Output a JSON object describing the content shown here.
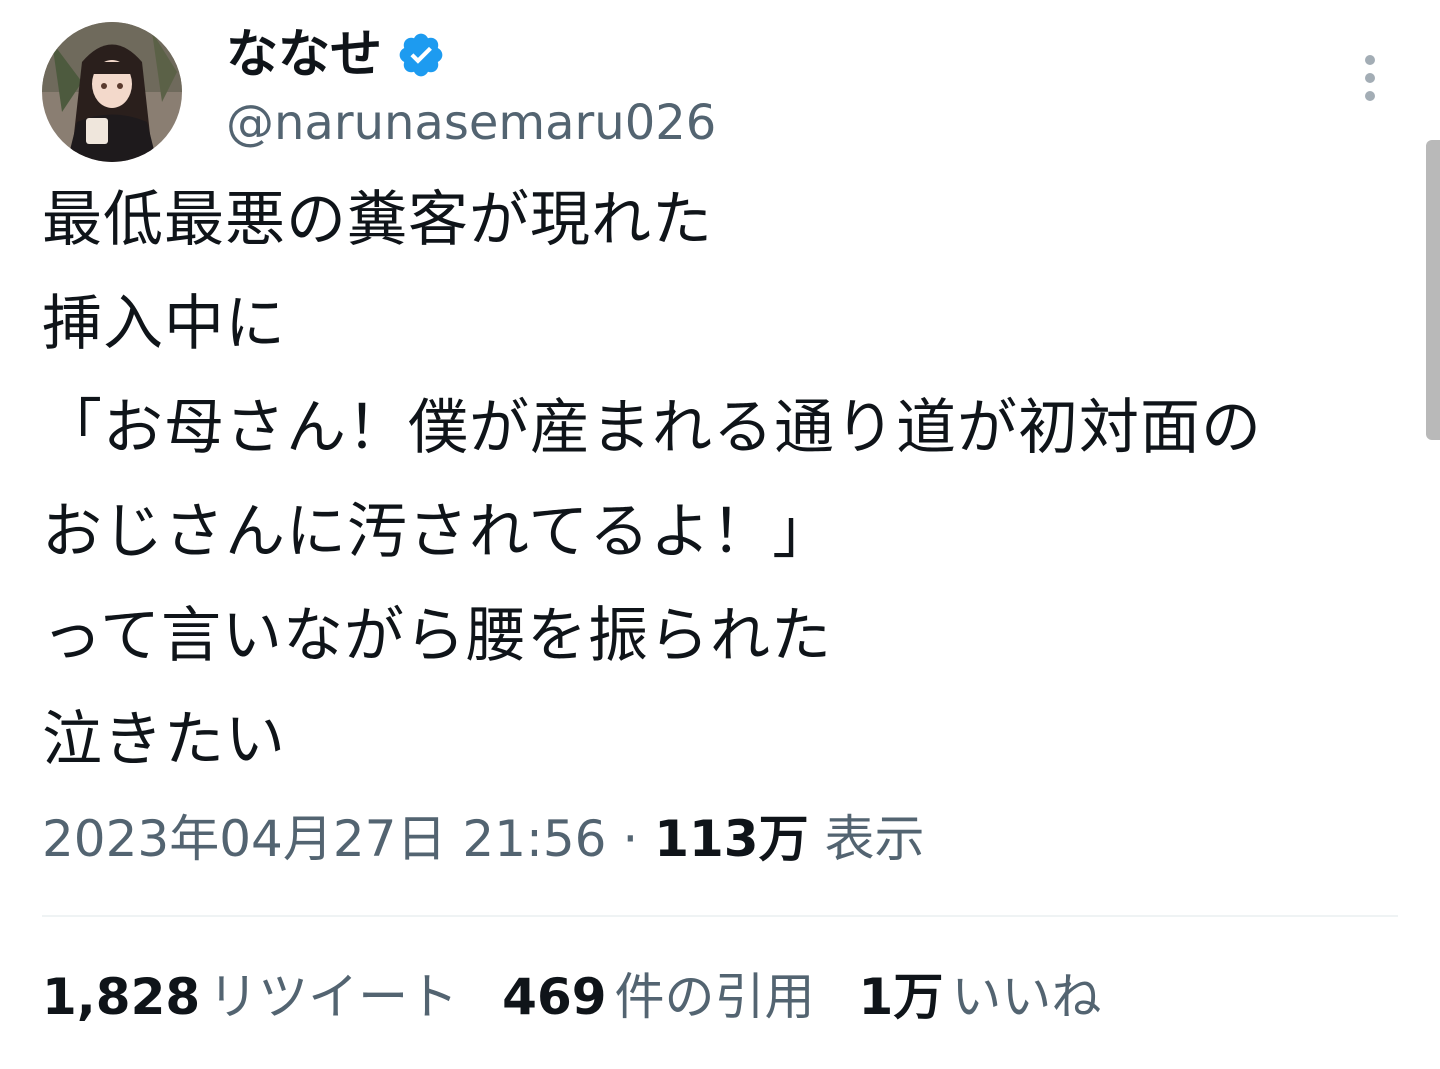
{
  "author": {
    "display_name": "ななせ",
    "handle": "@narunasemaru026",
    "verified_icon": "verified-badge-icon",
    "verified_color": "#1d9bf0"
  },
  "tweet": {
    "lines": [
      "最低最悪の糞客が現れた",
      "挿入中に",
      "「お母さん！僕が産まれる通り道が初対面の",
      "おじさんに汚されてるよ！」",
      "って言いながら腰を振られた",
      "泣きたい"
    ]
  },
  "meta": {
    "timestamp": "2023年04月27日 21:56",
    "separator": "·",
    "views_count": "113万",
    "views_label": "表示"
  },
  "stats": {
    "retweets_count": "1,828",
    "retweets_label": "リツイート",
    "quotes_count": "469",
    "quotes_label": "件の引用",
    "likes_count": "1万",
    "likes_label": "いいね"
  },
  "icons": {
    "more": "more-vertical-icon"
  },
  "colors": {
    "text_primary": "#0f1419",
    "text_secondary": "#536471",
    "divider": "#eff3f4"
  }
}
